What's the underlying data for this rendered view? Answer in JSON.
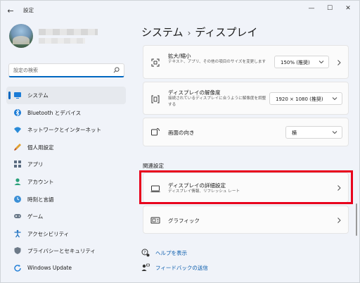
{
  "window": {
    "app_title": "設定",
    "back_glyph": "←",
    "minimize_glyph": "—",
    "maximize_glyph": "☐",
    "close_glyph": "✕"
  },
  "search": {
    "placeholder": "設定の検索"
  },
  "sidebar": {
    "items": [
      {
        "label": "システム",
        "icon": "system-icon",
        "active": true
      },
      {
        "label": "Bluetooth とデバイス",
        "icon": "bluetooth-icon"
      },
      {
        "label": "ネットワークとインターネット",
        "icon": "network-icon"
      },
      {
        "label": "個人用設定",
        "icon": "personalization-icon"
      },
      {
        "label": "アプリ",
        "icon": "apps-icon"
      },
      {
        "label": "アカウント",
        "icon": "account-icon"
      },
      {
        "label": "時刻と言語",
        "icon": "time-language-icon"
      },
      {
        "label": "ゲーム",
        "icon": "gaming-icon"
      },
      {
        "label": "アクセシビリティ",
        "icon": "accessibility-icon"
      },
      {
        "label": "プライバシーとセキュリティ",
        "icon": "privacy-icon"
      },
      {
        "label": "Windows Update",
        "icon": "windows-update-icon"
      }
    ]
  },
  "header": {
    "crumb_parent": "システム",
    "crumb_sep": "›",
    "crumb_current": "ディスプレイ"
  },
  "settings": {
    "scale": {
      "title": "拡大/縮小",
      "sub": "テキスト、アプリ、その他の項目のサイズを変更します",
      "value": "150% (推奨)"
    },
    "resolution": {
      "title": "ディスプレイの解像度",
      "sub": "接続されているディスプレイに合うように解像度を調整する",
      "value": "1920 × 1080 (推奨)"
    },
    "orientation": {
      "title": "画面の向き",
      "value": "横"
    }
  },
  "related": {
    "heading": "関連設定",
    "advanced": {
      "title": "ディスプレイの詳細設定",
      "sub": "ディスプレイ情報、リフレッシュ レート"
    },
    "graphics": {
      "title": "グラフィック"
    }
  },
  "help": {
    "get_help": "ヘルプを表示",
    "feedback": "フィードバックの送信"
  },
  "colors": {
    "accent": "#0067c0",
    "highlight": "#e8001c",
    "link": "#0a5cad"
  }
}
